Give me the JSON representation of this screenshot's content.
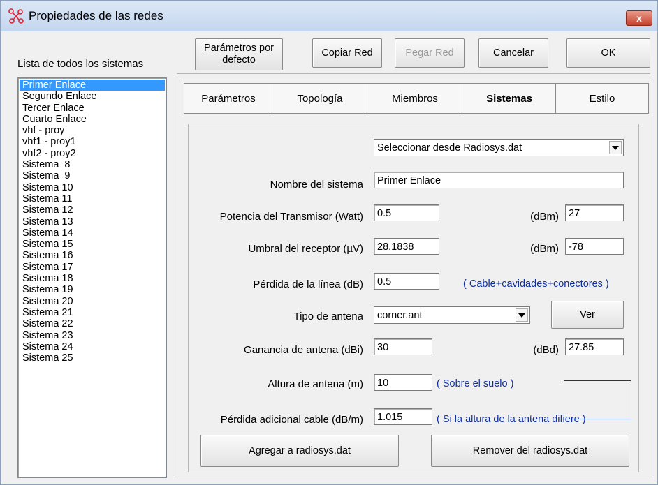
{
  "window": {
    "title": "Propiedades de las redes",
    "close_label": "x"
  },
  "system_list": {
    "label": "Lista de todos los sistemas",
    "items": [
      "Primer Enlace",
      "Segundo Enlace",
      "Tercer Enlace",
      "Cuarto Enlace",
      "vhf - proy",
      "vhf1 - proy1",
      "vhf2 - proy2",
      "Sistema  8",
      "Sistema  9",
      "Sistema 10",
      "Sistema 11",
      "Sistema 12",
      "Sistema 13",
      "Sistema 14",
      "Sistema 15",
      "Sistema 16",
      "Sistema 17",
      "Sistema 18",
      "Sistema 19",
      "Sistema 20",
      "Sistema 21",
      "Sistema 22",
      "Sistema 23",
      "Sistema 24",
      "Sistema 25"
    ],
    "selected": "Primer Enlace"
  },
  "toolbar": {
    "defaults_label": "Parámetros por defecto",
    "copy_label": "Copiar Red",
    "paste_label": "Pegar Red",
    "cancel_label": "Cancelar",
    "ok_label": "OK"
  },
  "tabs": [
    {
      "label": "Parámetros"
    },
    {
      "label": "Topología"
    },
    {
      "label": "Miembros"
    },
    {
      "label": "Sistemas",
      "active": true
    },
    {
      "label": "Estilo"
    }
  ],
  "form": {
    "source_select": "Seleccionar desde Radiosys.dat",
    "system_name_label": "Nombre del sistema",
    "system_name_value": "Primer Enlace",
    "tx_power_label": "Potencia del Transmisor (Watt)",
    "tx_power_value": "0.5",
    "tx_power_dbm_label": "(dBm)",
    "tx_power_dbm_value": "27",
    "rx_threshold_label": "Umbral del receptor (µV)",
    "rx_threshold_value": "28.1838",
    "rx_threshold_dbm_label": "(dBm)",
    "rx_threshold_dbm_value": "-78",
    "line_loss_label": "Pérdida de la línea (dB)",
    "line_loss_value": "0.5",
    "line_loss_note": "( Cable+cavidades+conectores )",
    "antenna_type_label": "Tipo de antena",
    "antenna_type_value": "corner.ant",
    "view_button": "Ver",
    "antenna_gain_label": "Ganancia de antena (dBi)",
    "antenna_gain_value": "30",
    "antenna_gain_dbd_label": "(dBd)",
    "antenna_gain_dbd_value": "27.85",
    "antenna_height_label": "Altura de antena (m)",
    "antenna_height_value": "10",
    "antenna_height_note": "( Sobre el suelo )",
    "extra_loss_label": "Pérdida adicional cable (dB/m)",
    "extra_loss_value": "1.015",
    "extra_loss_note": "( Si la altura de la antena difiere )",
    "add_button": "Agregar a radiosys.dat",
    "remove_button": "Remover del radiosys.dat"
  },
  "colors": {
    "selection": "#3399ff",
    "note": "#1030a0",
    "titlebar": "#c4d6ee"
  },
  "icons": {
    "app": "network-icon",
    "close": "close-icon",
    "dropdown": "chevron-down-icon"
  }
}
